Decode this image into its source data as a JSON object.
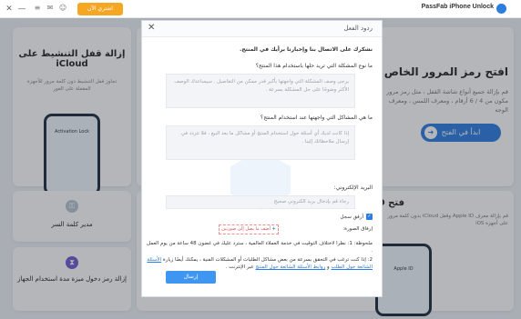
{
  "titlebar": {
    "app_title": "PassFab iPhone Unlock",
    "upgrade_label": "اشتري الآن",
    "minimize": "—",
    "close": "✕"
  },
  "background": {
    "icloud_card": {
      "title": "إزالة قفل التنشيط على iCloud",
      "desc": "تجاوز قفل التنشيط دون كلمة مرور للأجهزة المقفلة على الفور",
      "phone_label": "Activation Lock"
    },
    "password_manager": {
      "label": "مدير كلمة السر"
    },
    "screen_time": {
      "label": "إزالة رمز دخول ميزة مدة استخدام الجهاز"
    },
    "unlock_card": {
      "title": "افتح رمز المرور الخاص",
      "desc": "قم بإزالة جميع أنواع شاشة القفل ، مثل رمز مرور مكون من 4 / 6 أرقام ، ومعرف اللمس ، ومعرف الوجه",
      "start_label": "ابدأ في الفتح"
    },
    "appleid_card": {
      "title": "فتح Apple ID",
      "desc": "قم بإزالة معرف Apple ID وقفل iCloud بدون كلمة مرور على أجهزة iOS",
      "phone_label": "Apple ID"
    }
  },
  "dialog": {
    "title": "ردود الفعل",
    "intro": "نشكرك على الاتصال بنا وإخبارنا برأيك في المنتج.",
    "q1": "ما نوع المشكلة التي تريد حلها باستخدام هذا المنتج؟",
    "q1_placeholder": "يرجى وصف المشكلة التي واجهتها بأكبر قدر ممكن من التفاصيل . سيساعدك الوصف الأكثر وضوحًا على حل المشكلة بسرعة .",
    "q2": "ما هي المشاكل التي واجهتها عند استخدام المنتج؟",
    "q2_placeholder": "إذا كانت لديك أي أسئلة حول استخدام المنتج أو مشاكل ما بعد البيع ، فلا تتردد في إرسال ملاحظاتك إلينا .",
    "email_label": "البريد الإلكتروني:",
    "email_placeholder": "رجاء قم بإدخال بريد الكتروني صحيح",
    "attach_log_label": "أرفق سجل",
    "attach_image_label": "إرفاق الصورة:",
    "attach_box_label": "أضف ما يصل إلى صورتين",
    "note1": "ملحوظة: 1: نظرا لاختلاف التوقيت في خدمة العملاء العالمية ، سترد عليك في غضون 48 ساعة من يوم العمل .",
    "note2_prefix": "2: إذا كنت ترغب في التحقق بسرعة من بعض مشاكل الطلبات أو المشكلات الفنية ، يمكنك أيضًا زيارة",
    "note2_link1": "الأسئلة الشائعة حول الطلب",
    "note2_and": "و",
    "note2_link2": "روابط الأسئلة الشائعة حول المنتج",
    "note2_suffix": "عبر الإنترنت .",
    "send_label": "إرسال",
    "close_icon": "✕"
  },
  "colors": {
    "accent": "#2b7de0",
    "upgrade": "#f5a623",
    "send": "#3e96f0"
  }
}
